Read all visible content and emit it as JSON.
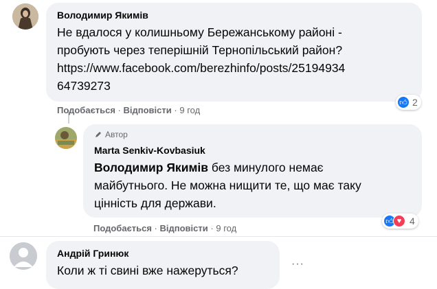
{
  "colors": {
    "bubble": "#f0f2f5",
    "meta": "#65676b",
    "like": "#1877f2",
    "love": "#f33e58"
  },
  "comments": [
    {
      "author": "Володимир Якимів",
      "lines": [
        "Не вдалося у колишньому Бережанському районі -",
        "пробують через теперішній Тернопільський район?",
        "https://www.facebook.com/berezhinfo/posts/25194934",
        "64739273"
      ],
      "actions": {
        "like": "Подобається",
        "reply": "Відповісти",
        "time": "9 год",
        "sep": "·"
      },
      "reactions": {
        "icons": [
          "like-icon"
        ],
        "count": "2"
      }
    },
    {
      "badge": "Автор",
      "author": "Marta Senkiv-Kovbasiuk",
      "mention": "Володимир Якимів",
      "lines": [
        " без минулого немає",
        "майбутнього. Не можна нищити те, що має таку",
        "цінність для держави."
      ],
      "actions": {
        "like": "Подобається",
        "reply": "Відповісти",
        "time": "9 год",
        "sep": "·"
      },
      "reactions": {
        "icons": [
          "like-icon",
          "love-icon"
        ],
        "count": "4"
      }
    },
    {
      "author": "Андрій Гринюк",
      "lines": [
        "Коли ж ті свині вже нажеруться?"
      ],
      "more": "···"
    }
  ]
}
